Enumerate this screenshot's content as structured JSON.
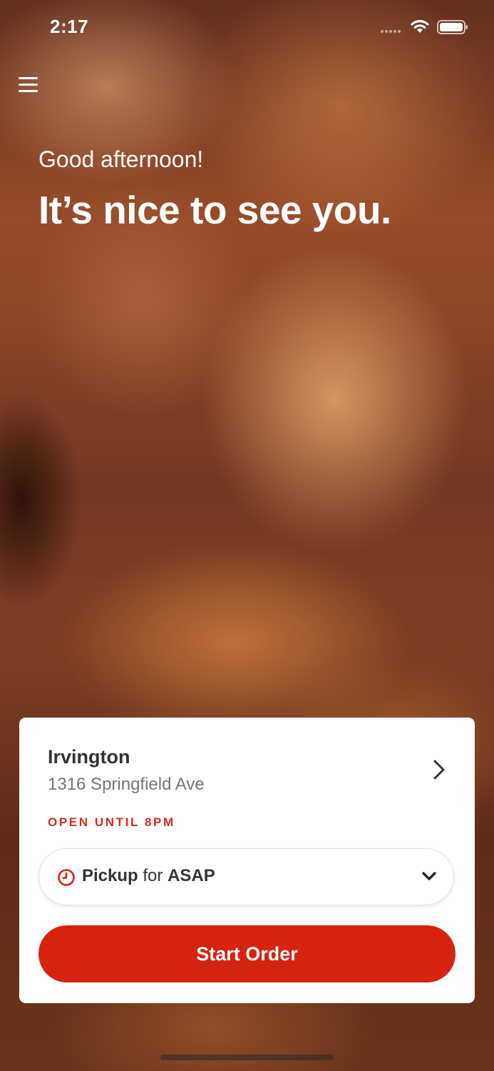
{
  "status_bar": {
    "time": "2:17"
  },
  "header": {
    "menu_icon": "hamburger-menu-icon"
  },
  "hero": {
    "greeting": "Good afternoon!",
    "headline": "It’s nice to see you.",
    "background": "grilled shrimp skewer photo"
  },
  "location": {
    "name": "Irvington",
    "address": "1316 Springfield Ave",
    "hours_status": "OPEN UNTIL 8PM",
    "chevron_icon": "chevron-right-icon"
  },
  "order_mode": {
    "mode": "Pickup",
    "connector": "for",
    "time": "ASAP",
    "icon": "clock-icon",
    "dropdown_icon": "chevron-down-icon"
  },
  "actions": {
    "start_order_label": "Start Order"
  },
  "colors": {
    "accent": "#d52310",
    "hours_text": "#d52b1e",
    "card_background": "#ffffff",
    "primary_text": "#333333",
    "secondary_text": "#767676"
  }
}
